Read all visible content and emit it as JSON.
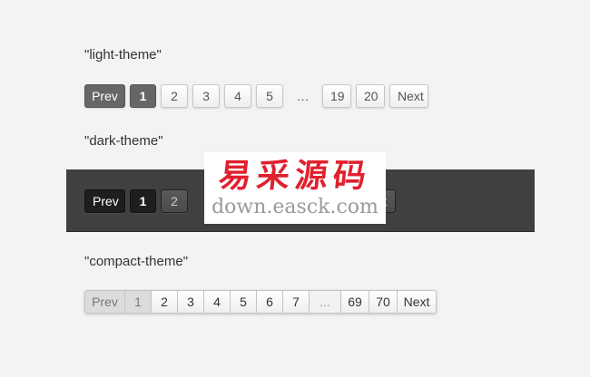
{
  "sections": {
    "light": {
      "label": "\"light-theme\"",
      "prev": "Prev",
      "pages_before": [
        "1",
        "2",
        "3",
        "4",
        "5"
      ],
      "ellipsis": "…",
      "pages_after": [
        "19",
        "20"
      ],
      "next": "Next",
      "current": "1"
    },
    "dark": {
      "label": "\"dark-theme\"",
      "prev": "Prev",
      "pages_visible": [
        "1",
        "2"
      ],
      "next_fragment": "t",
      "current": "1"
    },
    "compact": {
      "label": "\"compact-theme\"",
      "prev": "Prev",
      "pages_before": [
        "1",
        "2",
        "3",
        "4",
        "5",
        "6",
        "7"
      ],
      "ellipsis": "...",
      "pages_after": [
        "69",
        "70"
      ],
      "next": "Next",
      "current": "1"
    }
  },
  "watermark": {
    "chinese": "易采源码",
    "url": "down.easck.com"
  },
  "colors": {
    "page_background": "#f3f3f3",
    "dark_panel": "#404040",
    "light_active": "#666666",
    "dark_active": "#1e1e1e",
    "compact_active": "#dcdcdc",
    "watermark_red": "#e0202e"
  }
}
